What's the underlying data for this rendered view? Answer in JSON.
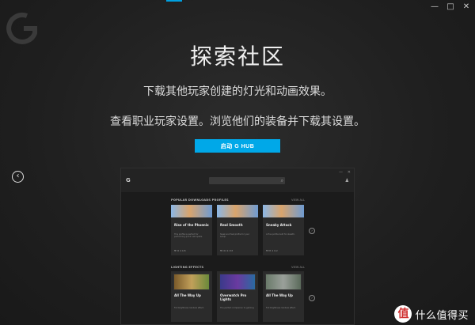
{
  "window": {
    "minimize": "—",
    "maximize": "□",
    "close": "✕"
  },
  "hero": {
    "title": "探索社区",
    "line1": "下载其他玩家创建的灯光和动画效果。",
    "line2": "查看职业玩家设置。浏览他们的装备并下载其设置。",
    "cta": "启动 G HUB"
  },
  "nav": {
    "prev": "‹"
  },
  "preview": {
    "logo": "G",
    "search_icon": "⌕",
    "user_icon": "♟",
    "section1": {
      "title": "POPULAR DOWNLOADS PROFILES",
      "more": "VIEW ALL"
    },
    "section2": {
      "title": "LIGHTING EFFECTS",
      "more": "VIEW ALL"
    },
    "profile_cards": [
      {
        "title": "Rise of the Phoenix",
        "desc": "This profile is perfect for performing quick cast spells.",
        "meta": "♥ 52   ⬇ 145"
      },
      {
        "title": "Real Smooth",
        "desc": "Sleek and fast profile for your setup.",
        "meta": "♥ 104  ⬇ 215"
      },
      {
        "title": "Sneaky Attack",
        "desc": "A fine profile built for stealth.",
        "meta": "♥ 85   ⬇ 112"
      }
    ],
    "lighting_cards": [
      {
        "title": "All The Way Up",
        "desc": "Full brightness rainbow effect.",
        "meta": "♥ 94   ⬇ 220"
      },
      {
        "title": "Overwatch Pro Lights",
        "desc": "The perfect companion to gaming.",
        "meta": "♥ 53   ⬇ 168"
      },
      {
        "title": "All The Way Up",
        "desc": "Full brightness rainbow effect.",
        "meta": "♥ 47   ⬇ 198"
      }
    ],
    "arrow": "›"
  },
  "watermark": {
    "badge": "值",
    "text": "什么值得买"
  },
  "colors": {
    "accent": "#00a8e8",
    "background": "#1f1f1f"
  }
}
